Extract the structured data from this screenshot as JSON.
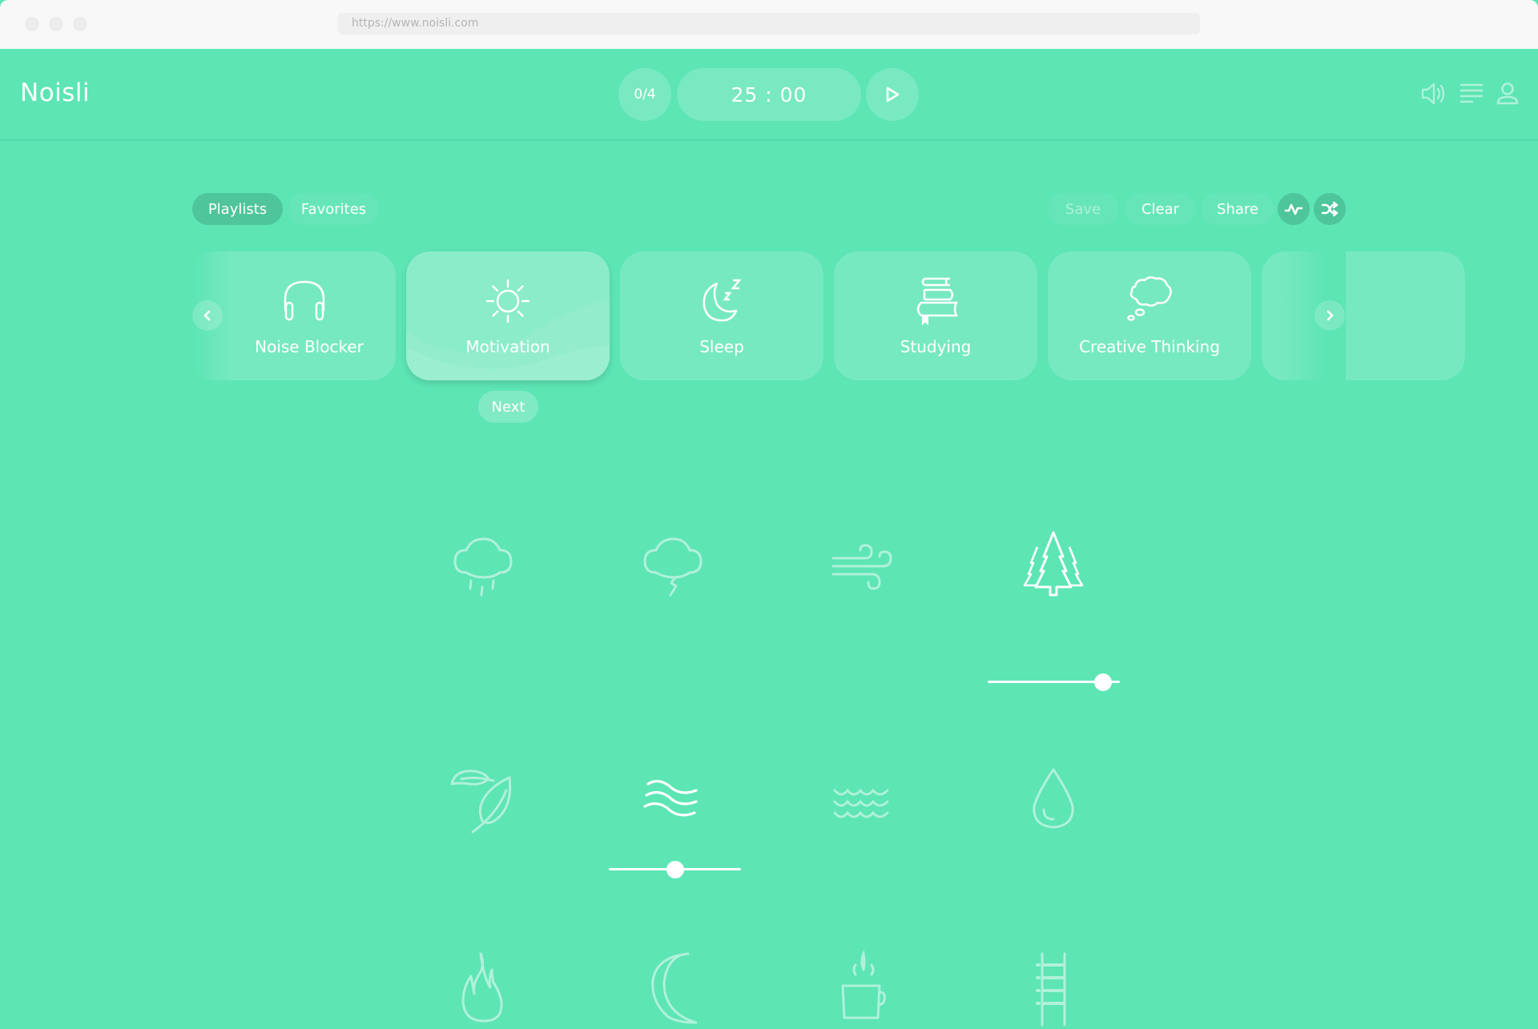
{
  "browser": {
    "url": "https://www.noisli.com"
  },
  "header": {
    "logo": "Noisli",
    "session_counter": "0/4",
    "timer": "25 : 00",
    "icons": [
      "volume-icon",
      "menu-icon",
      "user-icon"
    ]
  },
  "tabs": [
    {
      "label": "Playlists",
      "active": true
    },
    {
      "label": "Favorites",
      "active": false
    }
  ],
  "actions": {
    "save": "Save",
    "clear": "Clear",
    "share": "Share",
    "icons": [
      "productivity-icon",
      "shuffle-icon"
    ]
  },
  "playlists": [
    {
      "label": "Noise Blocker",
      "icon": "headphones-icon"
    },
    {
      "label": "Motivation",
      "icon": "sun-icon",
      "selected": true
    },
    {
      "label": "Sleep",
      "icon": "moon-zzz-icon"
    },
    {
      "label": "Studying",
      "icon": "books-icon"
    },
    {
      "label": "Creative Thinking",
      "icon": "thought-cloud-icon"
    }
  ],
  "next_label": "Next",
  "sounds": [
    {
      "name": "rain",
      "active": false
    },
    {
      "name": "thunderstorm",
      "active": false
    },
    {
      "name": "wind",
      "active": false
    },
    {
      "name": "forest",
      "active": true,
      "volume": 0.87
    },
    {
      "name": "leaves",
      "active": false
    },
    {
      "name": "water-stream",
      "active": true,
      "volume": 0.5
    },
    {
      "name": "seaside",
      "active": false
    },
    {
      "name": "water-drop",
      "active": false
    },
    {
      "name": "fire",
      "active": false
    },
    {
      "name": "summer-night",
      "active": false
    },
    {
      "name": "coffee-shop",
      "active": false
    },
    {
      "name": "train",
      "active": false
    }
  ],
  "colors": {
    "background": "#5de5b4",
    "accent_dark": "#4fc59b",
    "icon_inactive": "#b0f1d8",
    "icon_active": "#ffffff"
  }
}
